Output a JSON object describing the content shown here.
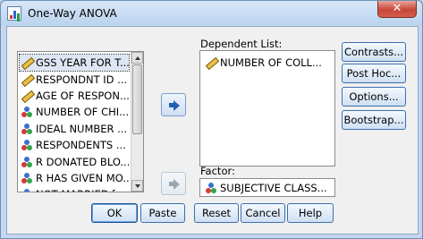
{
  "window": {
    "title": "One-Way ANOVA",
    "close_glyph": "✕"
  },
  "variables": {
    "items": [
      {
        "label": "GSS YEAR FOR T...",
        "icon": "scale-ruler-icon",
        "selected": true
      },
      {
        "label": "RESPONDNT ID ...",
        "icon": "scale-ruler-icon"
      },
      {
        "label": "AGE OF RESPON...",
        "icon": "scale-ruler-icon"
      },
      {
        "label": "NUMBER OF CHI...",
        "icon": "nominal-balls-icon"
      },
      {
        "label": "IDEAL NUMBER ...",
        "icon": "nominal-balls-icon"
      },
      {
        "label": "RESPONDENTS ...",
        "icon": "nominal-balls-icon"
      },
      {
        "label": "R DONATED BLO...",
        "icon": "nominal-balls-icon"
      },
      {
        "label": "R HAS GIVEN MO...",
        "icon": "nominal-balls-icon"
      },
      {
        "label": "NOT MARRIED [a...",
        "icon": "nominal-balls-icon"
      }
    ]
  },
  "dependent": {
    "label": "Dependent List:",
    "items": [
      {
        "label": "NUMBER OF COLL...",
        "icon": "scale-ruler-icon"
      }
    ]
  },
  "factor": {
    "label": "Factor:",
    "value": "SUBJECTIVE CLASS...",
    "icon": "nominal-balls-icon"
  },
  "side_buttons": {
    "contrasts": "Contrasts...",
    "post_hoc": "Post Hoc...",
    "options": "Options...",
    "bootstrap": "Bootstrap..."
  },
  "bottom_buttons": {
    "ok": "OK",
    "paste": "Paste",
    "reset": "Reset",
    "cancel": "Cancel",
    "help": "Help"
  }
}
